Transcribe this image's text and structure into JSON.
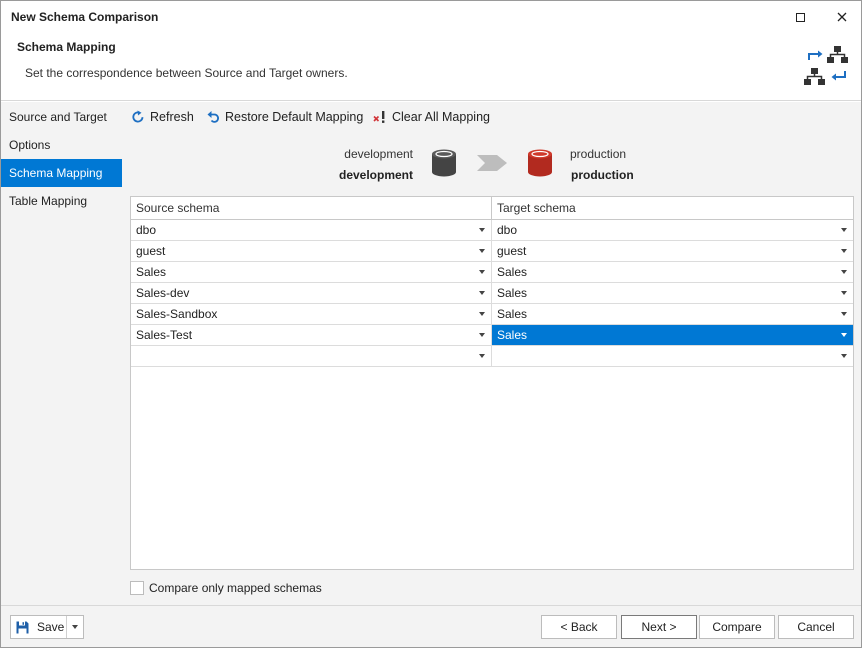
{
  "window": {
    "title": "New Schema Comparison"
  },
  "header": {
    "title": "Schema Mapping",
    "subtitle": "Set the correspondence between Source and Target owners.",
    "icon": "schema-mapping-icon"
  },
  "sidebar": {
    "items": [
      {
        "label": "Source and Target",
        "active": false
      },
      {
        "label": "Options",
        "active": false
      },
      {
        "label": "Schema Mapping",
        "active": true
      },
      {
        "label": "Table Mapping",
        "active": false
      }
    ]
  },
  "toolbar": {
    "refresh_label": "Refresh",
    "restore_label": "Restore Default Mapping",
    "clear_label": "Clear All Mapping"
  },
  "connection": {
    "source_server": "development",
    "source_database": "development",
    "target_server": "production",
    "target_database": "production",
    "source_color": "#444444",
    "target_color": "#b22a1f"
  },
  "grid": {
    "headers": {
      "source": "Source schema",
      "target": "Target schema"
    },
    "rows": [
      {
        "source": "dbo",
        "target": "dbo"
      },
      {
        "source": "guest",
        "target": "guest"
      },
      {
        "source": "Sales",
        "target": "Sales"
      },
      {
        "source": "Sales-dev",
        "target": "Sales"
      },
      {
        "source": "Sales-Sandbox",
        "target": "Sales"
      },
      {
        "source": "Sales-Test",
        "target": "Sales",
        "selected": true
      },
      {
        "source": "",
        "target": ""
      }
    ]
  },
  "options": {
    "compare_only_mapped_label": "Compare only mapped schemas",
    "compare_only_mapped_checked": false
  },
  "footer": {
    "save_label": "Save",
    "back_label": "< Back",
    "next_label": "Next >",
    "compare_label": "Compare",
    "cancel_label": "Cancel"
  },
  "colors": {
    "accent": "#0078d4",
    "panel_bg": "#f3f3f3",
    "clear_icon_red": "#d13438"
  }
}
